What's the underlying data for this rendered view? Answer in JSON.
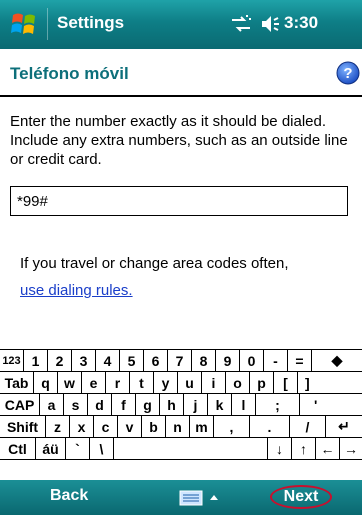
{
  "titlebar": {
    "app_title": "Settings",
    "time": "3:30",
    "icons": [
      "windows-start-icon",
      "connectivity-icon",
      "volume-icon"
    ]
  },
  "header": {
    "title": "Teléfono móvil",
    "help_icon": "help-icon"
  },
  "content": {
    "instruction": "Enter the number exactly as it should be dialed.  Include any extra numbers, such as an outside line or credit card.",
    "number_value": "*99#",
    "travel_text": "If you travel or change area codes often,",
    "dialing_rules_link": "use dialing rules."
  },
  "keyboard": {
    "rows": [
      [
        "123",
        "1",
        "2",
        "3",
        "4",
        "5",
        "6",
        "7",
        "8",
        "9",
        "0",
        "-",
        "=",
        "◆"
      ],
      [
        "Tab",
        "q",
        "w",
        "e",
        "r",
        "t",
        "y",
        "u",
        "i",
        "o",
        "p",
        "[",
        "]"
      ],
      [
        "CAP",
        "a",
        "s",
        "d",
        "f",
        "g",
        "h",
        "j",
        "k",
        "l",
        ";",
        "'"
      ],
      [
        "Shift",
        "z",
        "x",
        "c",
        "v",
        "b",
        "n",
        "m",
        ",",
        ".",
        "/",
        "↵"
      ],
      [
        "Ctl",
        "áü",
        "`",
        "\\",
        "",
        "↓",
        "↑",
        "←",
        "→"
      ]
    ]
  },
  "softkeys": {
    "left": "Back",
    "right": "Next",
    "keyboard_toggle_icon": "keyboard-icon"
  },
  "colors": {
    "titlebar": "#0e7e86",
    "page_title": "#0d6f7a",
    "link": "#1a3ec9",
    "next_highlight": "#c8102e"
  }
}
